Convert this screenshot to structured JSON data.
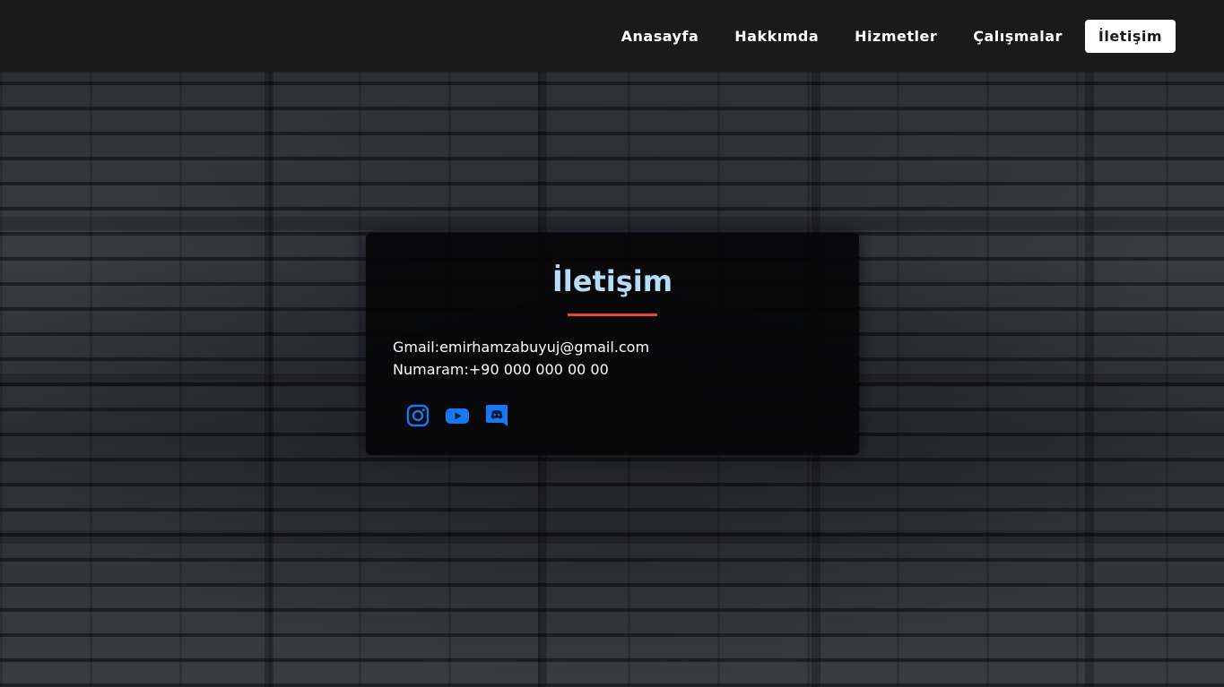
{
  "nav": {
    "items": [
      {
        "label": "Anasayfa"
      },
      {
        "label": "Hakkımda"
      },
      {
        "label": "Hizmetler"
      },
      {
        "label": "Çalışmalar"
      },
      {
        "label": "İletişim",
        "active": true
      }
    ]
  },
  "contact": {
    "title": "İletişim",
    "gmail_label": "Gmail:",
    "gmail_value": "emirhamzabuyuj@gmail.com",
    "phone_label": "Numaram:",
    "phone_value": "+90 000 000 00 00",
    "social": [
      {
        "icon": "instagram-icon"
      },
      {
        "icon": "youtube-icon"
      },
      {
        "icon": "discord-icon"
      }
    ]
  },
  "colors": {
    "nav_bg": "#1a1a1a",
    "title": "#b6dcf6",
    "underline": "#e0483c",
    "icon_blue": "#1877f2"
  }
}
